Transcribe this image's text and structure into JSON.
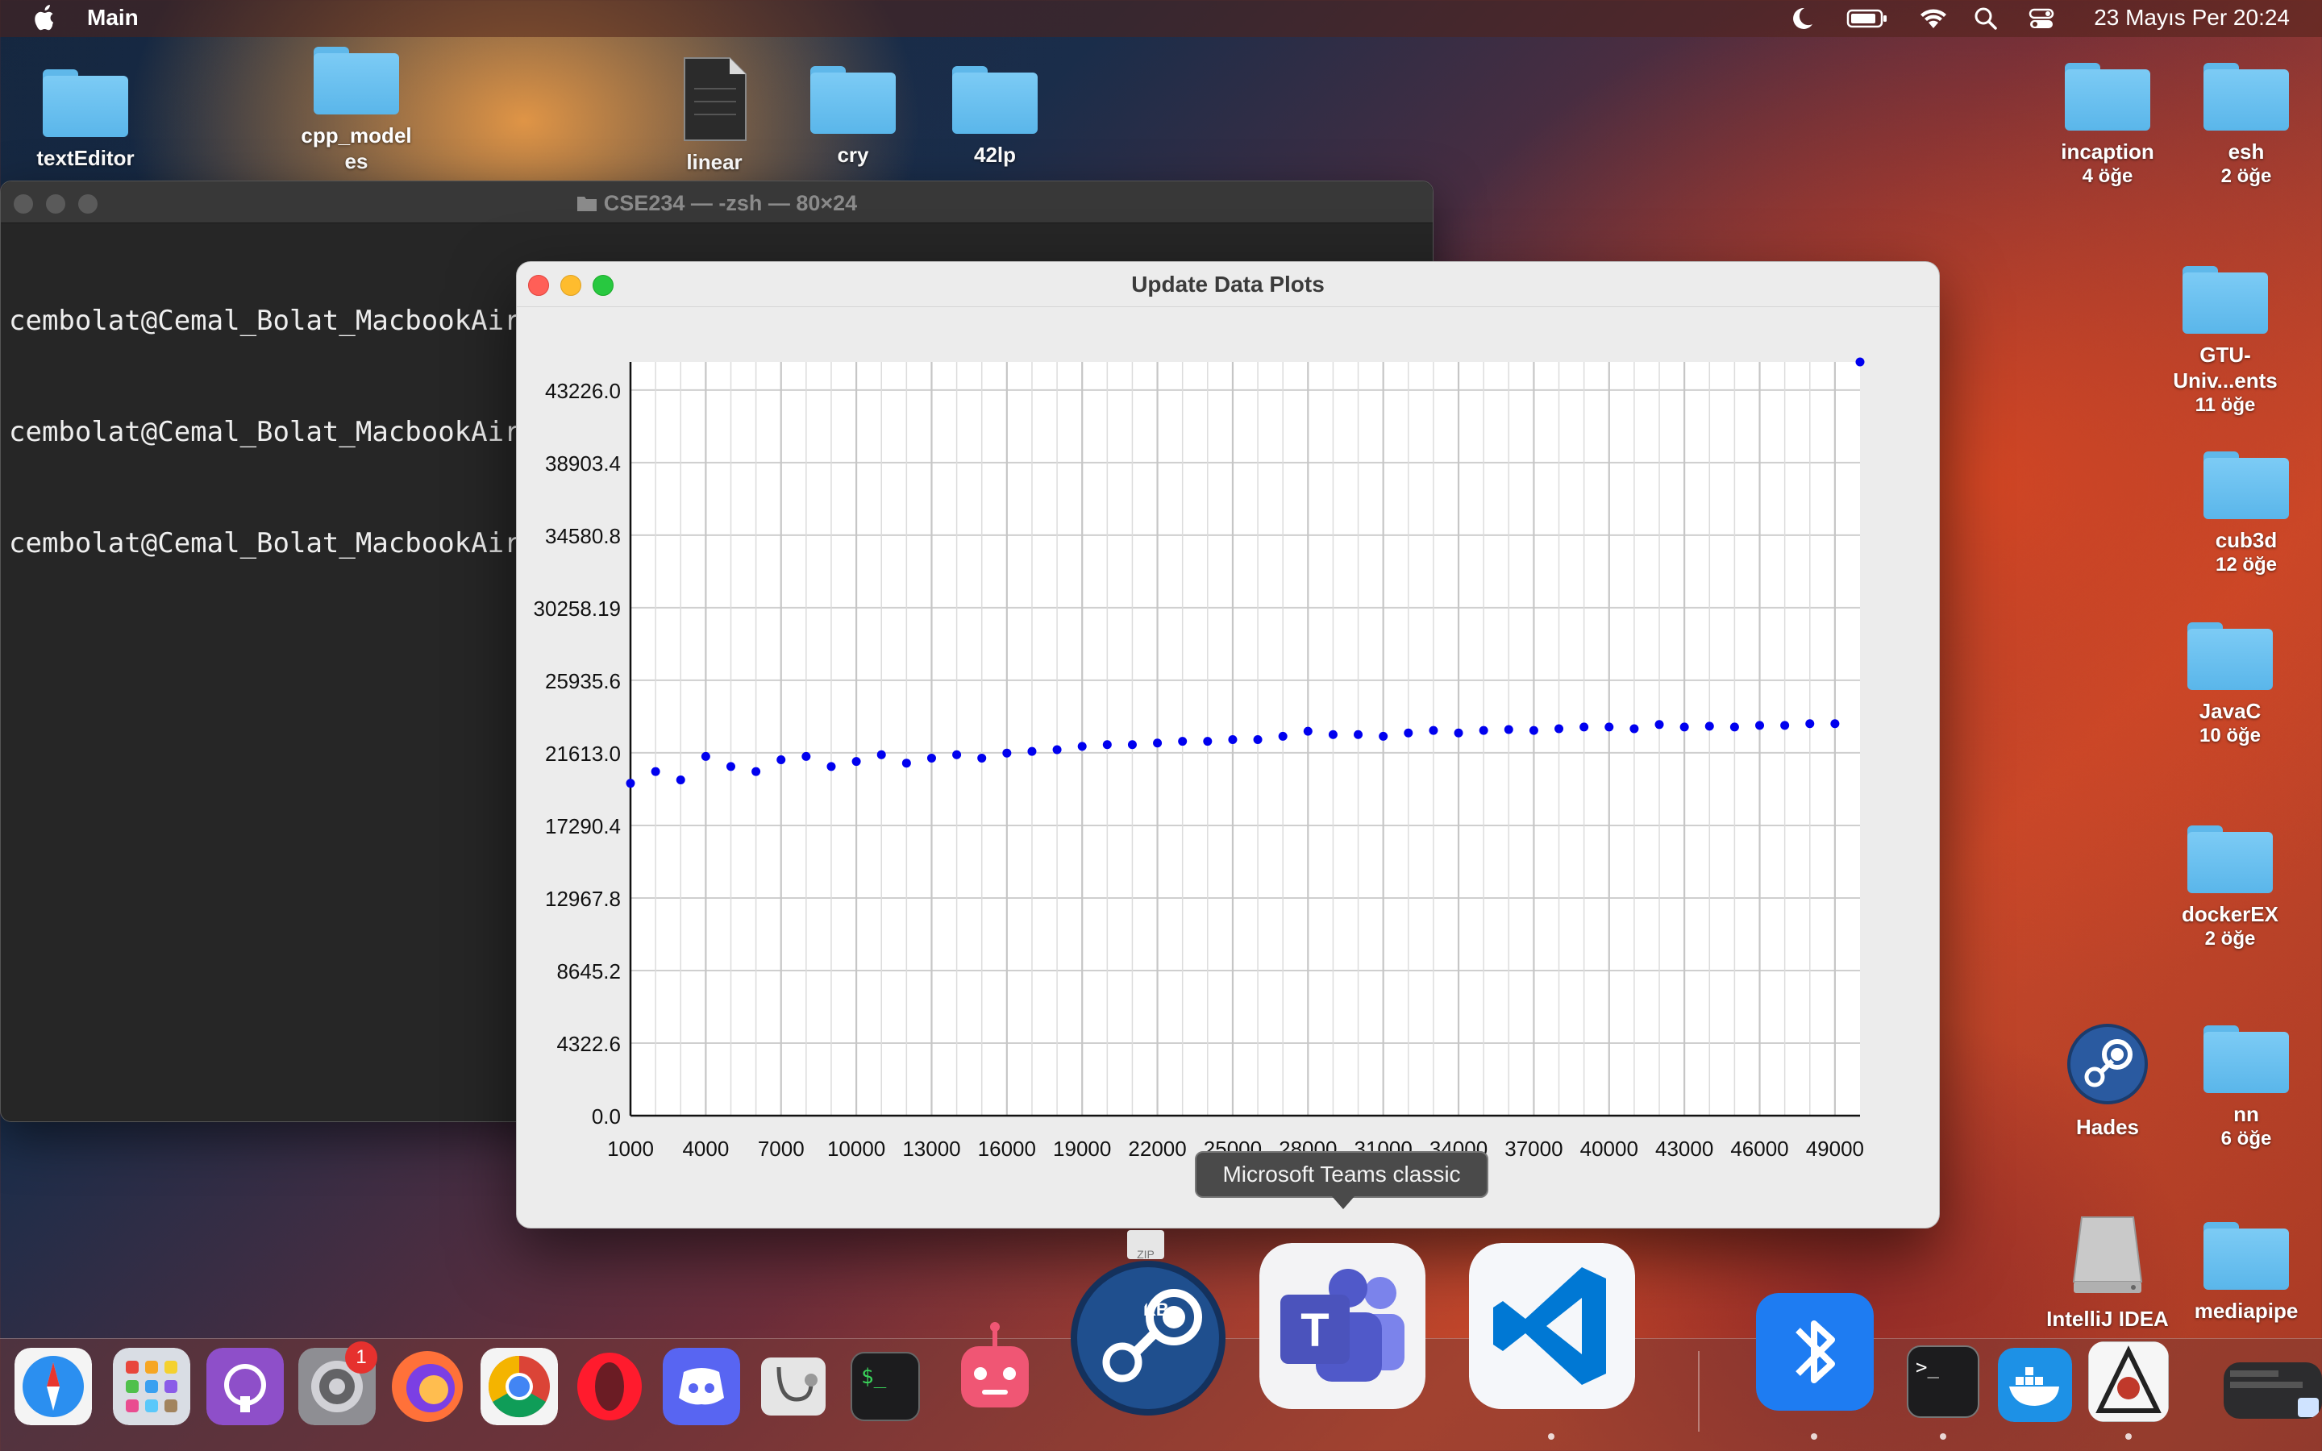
{
  "menubar": {
    "app_name": "Main",
    "clock": "23 Mayıs Per  20:24",
    "status_icons": [
      "moon-icon",
      "battery-icon",
      "wifi-icon",
      "search-icon",
      "control-center-icon"
    ]
  },
  "desktop_icons": [
    {
      "id": "textEditor",
      "label": "textEditor",
      "sub": ""
    },
    {
      "id": "cpp_models",
      "label": "cpp_model",
      "label2": "es",
      "sub": ""
    },
    {
      "id": "linear",
      "label": "linear",
      "sub": ""
    },
    {
      "id": "cry",
      "label": "cry",
      "sub": ""
    },
    {
      "id": "42lp",
      "label": "42lp",
      "sub": ""
    },
    {
      "id": "incaption",
      "label": "incaption",
      "sub": "4 öğe"
    },
    {
      "id": "esh",
      "label": "esh",
      "sub": "2 öğe"
    },
    {
      "id": "gtu",
      "label": "GTU-",
      "label2": "Univ...ents",
      "sub": "11 öğe"
    },
    {
      "id": "cub3d",
      "label": "cub3d",
      "sub": "12 öğe"
    },
    {
      "id": "javac",
      "label": "JavaC",
      "sub": "10 öğe"
    },
    {
      "id": "dockerex",
      "label": "dockerEX",
      "sub": "2 öğe"
    },
    {
      "id": "hades",
      "label": "Hades",
      "sub": ""
    },
    {
      "id": "nn",
      "label": "nn",
      "sub": "6 öğe"
    },
    {
      "id": "intellij",
      "label": "IntelliJ IDEA",
      "sub": ""
    },
    {
      "id": "mediapipe",
      "label": "mediapipe",
      "sub": ""
    }
  ],
  "terminal": {
    "title": "CSE234 — -zsh — 80×24",
    "lines": [
      "cembolat@Cemal_Bolat_MacbookAir CSE234 % open .",
      "cembolat@Cemal_Bolat_MacbookAir",
      "cembolat@Cemal_Bolat_MacbookAir"
    ]
  },
  "plot_window": {
    "title": "Update Data Plots"
  },
  "tooltip": "Microsoft Teams classic",
  "dock": {
    "settings_badge": "1",
    "zip_label": "ZIP",
    "download_label": "KB",
    "apps": [
      "safari",
      "launchpad",
      "github-desktop",
      "system-settings",
      "firefox",
      "chrome",
      "opera",
      "discord",
      "disk-utility",
      "terminal",
      "bot",
      "steam",
      "teams",
      "vscode",
      "bluetooth",
      "terminal-2",
      "docker",
      "java-launcher",
      "screen-recorder"
    ]
  },
  "chart_data": {
    "type": "scatter",
    "title": "",
    "xlabel": "",
    "ylabel": "",
    "x_ticks": [
      "1000",
      "4000",
      "7000",
      "10000",
      "13000",
      "16000",
      "19000",
      "22000",
      "25000",
      "28000",
      "31000",
      "34000",
      "37000",
      "40000",
      "43000",
      "46000",
      "49000"
    ],
    "y_ticks": [
      "0.0",
      "4322.6",
      "8645.2",
      "12967.8",
      "17290.4",
      "21613.0",
      "25935.6",
      "30258.19",
      "34580.8",
      "38903.4",
      "43226.0"
    ],
    "xlim": [
      1000,
      50000
    ],
    "ylim": [
      0,
      44900
    ],
    "grid": true,
    "color": "#0000ee",
    "x": [
      1000,
      2000,
      3000,
      4000,
      5000,
      6000,
      7000,
      8000,
      9000,
      10000,
      11000,
      12000,
      13000,
      14000,
      15000,
      16000,
      17000,
      18000,
      19000,
      20000,
      21000,
      22000,
      23000,
      24000,
      25000,
      26000,
      27000,
      28000,
      29000,
      30000,
      31000,
      32000,
      33000,
      34000,
      35000,
      36000,
      37000,
      38000,
      39000,
      40000,
      41000,
      42000,
      43000,
      44000,
      45000,
      46000,
      47000,
      48000,
      49000,
      50000
    ],
    "y": [
      19800,
      20500,
      20000,
      21400,
      20800,
      20500,
      21200,
      21400,
      20800,
      21100,
      21500,
      21000,
      21300,
      21500,
      21300,
      21600,
      21700,
      21800,
      22000,
      22100,
      22100,
      22200,
      22300,
      22300,
      22400,
      22400,
      22600,
      22900,
      22700,
      22700,
      22600,
      22800,
      22950,
      22800,
      22950,
      23000,
      22950,
      23050,
      23150,
      23150,
      23050,
      23300,
      23150,
      23200,
      23150,
      23250,
      23250,
      23350,
      23350,
      44900
    ]
  }
}
